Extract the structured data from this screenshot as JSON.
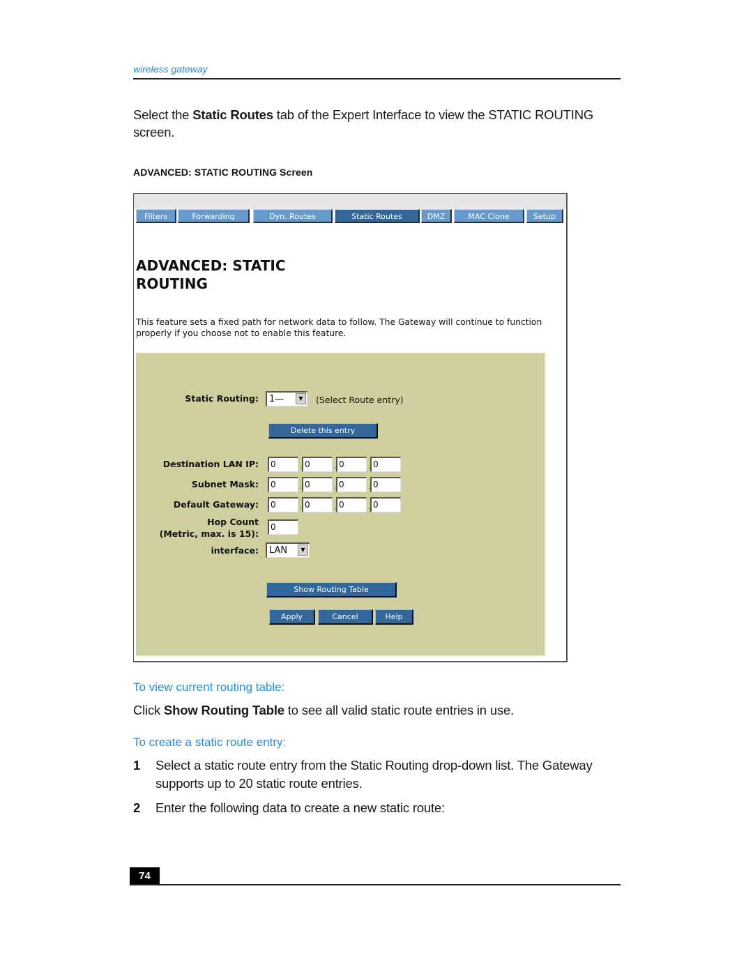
{
  "running_header": "wireless gateway",
  "intro": {
    "before": "Select the ",
    "bold": "Static Routes",
    "after": " tab of the Expert Interface to view the STATIC ROUTING screen."
  },
  "figure_caption": "ADVANCED: STATIC ROUTING Screen",
  "ui": {
    "tabs": [
      {
        "label": "Filters",
        "active": false
      },
      {
        "label": "Forwarding",
        "active": false
      },
      {
        "label": "Dyn. Routes",
        "active": false
      },
      {
        "label": "Static Routes",
        "active": true
      },
      {
        "label": "DMZ",
        "active": false
      },
      {
        "label": "MAC Clone",
        "active": false
      },
      {
        "label": "Setup",
        "active": false
      }
    ],
    "title_line1": "ADVANCED: STATIC",
    "title_line2": "ROUTING",
    "description": "This feature sets a fixed path for network data to follow. The Gateway will continue to function properly if you choose not to enable this feature.",
    "static_routing": {
      "label": "Static Routing:",
      "selected": "1—",
      "hint": "(Select Route entry)"
    },
    "delete_button": "Delete this entry",
    "fields": {
      "destination_lan_ip": {
        "label": "Destination LAN IP:",
        "octets": [
          "0",
          "0",
          "0",
          "0"
        ]
      },
      "subnet_mask": {
        "label": "Subnet Mask:",
        "octets": [
          "0",
          "0",
          "0",
          "0"
        ]
      },
      "default_gateway": {
        "label": "Default Gateway:",
        "octets": [
          "0",
          "0",
          "0",
          "0"
        ]
      }
    },
    "hop_count": {
      "label_line1": "Hop Count",
      "label_line2": "(Metric, max. is 15):",
      "value": "0"
    },
    "interface": {
      "label": "interface:",
      "selected": "LAN"
    },
    "show_routing_table_button": "Show Routing Table",
    "apply_button": "Apply",
    "cancel_button": "Cancel",
    "help_button": "Help",
    "colors": {
      "tab": "#6699cc",
      "tab_active": "#336699",
      "panel": "#cfcf9f"
    }
  },
  "section_view": {
    "heading": "To view current routing table:",
    "before": "Click ",
    "bold": "Show Routing Table",
    "after": " to see all valid static route entries in use."
  },
  "section_create": {
    "heading": "To create a static route entry:",
    "steps": [
      {
        "num": "1",
        "text": "Select a static route entry from the Static Routing drop-down list. The Gateway supports up to 20 static route entries."
      },
      {
        "num": "2",
        "text": "Enter the following data to create a new static route:"
      }
    ]
  },
  "page_number": "74"
}
